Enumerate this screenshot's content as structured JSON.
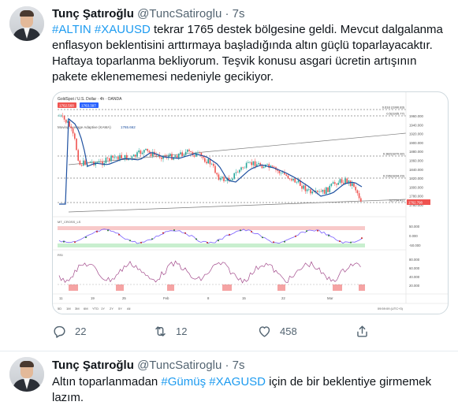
{
  "tweets": [
    {
      "name": "Tunç Şatıroğlu",
      "handle": "@TuncSatiroglu",
      "separator": "·",
      "time": "7s",
      "text_parts": [
        "#ALTIN",
        " ",
        "#XAUUSD",
        " tekrar 1765 destek bölgesine geldi. Mevcut dalgalanma enflasyon beklentisini arttırmaya başladığında altın güçlü toparlayacaktır. Haftaya toparlanma bekliyorum. Teşvik konusu asgari ücretin artışının pakete eklenememesi nedeniyle gecikiyor."
      ],
      "stats": {
        "replies": "22",
        "retweets": "12",
        "likes": "458"
      }
    },
    {
      "name": "Tunç Şatıroğlu",
      "handle": "@TuncSatiroglu",
      "separator": "·",
      "time": "7s",
      "text_parts": [
        "Altın toparlanmadan ",
        "#Gümüş",
        " ",
        "#XAGUSD",
        " için de bir beklentiye girmemek lazım."
      ]
    }
  ],
  "chart": {
    "header": "GoldSpot / U.S. Dollar · 4h · OANDA",
    "sell_box": "1762.568",
    "buy_box": "1763.397",
    "ma_label": "Moving Average Adaptive (KAMA)",
    "ma_value": "1765.662",
    "price_axis": [
      "1960.000",
      "1940.000",
      "1920.000",
      "1900.000",
      "1880.000",
      "1860.000",
      "1840.000",
      "1820.000",
      "1800.000",
      "1780.000",
      "1760.000"
    ],
    "current_price": "1762.798",
    "fib_levels": [
      "0.618 (1990.83)",
      "0.5(1935.77)",
      "0.382(1870.92)",
      "0.236(1834.23)",
      "0(1764.41)"
    ],
    "osc1_label": "MT_CROSS_LS",
    "osc1_axis": [
      "50.000",
      "0.000",
      "-50.000"
    ],
    "osc2_label": "RSI",
    "osc2_axis": [
      "80.000",
      "60.000",
      "40.000",
      "20.000"
    ],
    "time_axis": [
      "11",
      "19",
      "25",
      "Feb",
      "8",
      "15",
      "22",
      "Mar"
    ],
    "footer_left": [
      "5D",
      "1M",
      "3M",
      "6M",
      "YTD",
      "1Y",
      "2Y",
      "5Y",
      "All"
    ],
    "footer_right": "09:59:09 (UTC+3)",
    "colors": {
      "candle_up": "#26a69a",
      "candle_down": "#ef5350",
      "ma_line": "#1e50a0",
      "osc_line": "#7b61ff",
      "rsi_line": "#a34b8c",
      "trend_line": "#7a7a7a",
      "tweet_link": "#1d9bf0"
    }
  }
}
